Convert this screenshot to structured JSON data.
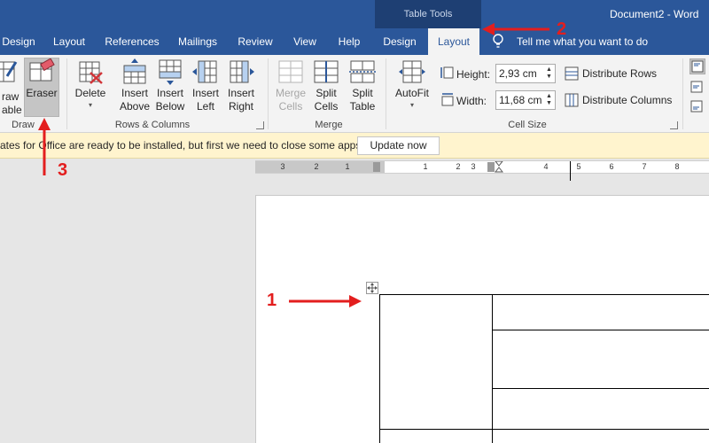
{
  "window": {
    "contextual_group": "Table Tools",
    "document_title": "Document2 - Word"
  },
  "tabs": [
    {
      "label": "Design"
    },
    {
      "label": "Layout"
    },
    {
      "label": "References"
    },
    {
      "label": "Mailings"
    },
    {
      "label": "Review"
    },
    {
      "label": "View"
    },
    {
      "label": "Help"
    },
    {
      "label": "Design"
    },
    {
      "label": "Layout",
      "active": true
    }
  ],
  "tell_me": "Tell me what you want to do",
  "ribbon": {
    "draw": {
      "draw_table": [
        "raw",
        "able"
      ],
      "eraser": "Eraser",
      "group_label": "Draw"
    },
    "rows_columns": {
      "delete": "Delete",
      "insert_above": [
        "Insert",
        "Above"
      ],
      "insert_below": [
        "Insert",
        "Below"
      ],
      "insert_left": [
        "Insert",
        "Left"
      ],
      "insert_right": [
        "Insert",
        "Right"
      ],
      "group_label": "Rows & Columns"
    },
    "merge": {
      "merge_cells": [
        "Merge",
        "Cells"
      ],
      "split_cells": [
        "Split",
        "Cells"
      ],
      "split_table": [
        "Split",
        "Table"
      ],
      "group_label": "Merge"
    },
    "cell_size": {
      "autofit": "AutoFit",
      "height_label": "Height:",
      "height_value": "2,93 cm",
      "width_label": "Width:",
      "width_value": "11,68 cm",
      "distribute_rows": "Distribute Rows",
      "distribute_columns": "Distribute Columns",
      "group_label": "Cell Size"
    }
  },
  "notification": {
    "message": "ates for Office are ready to be installed, but first we need to close some apps.",
    "button": "Update now"
  },
  "ruler": {
    "labels": [
      "3",
      "2",
      "1",
      "1",
      "2",
      "3",
      "4",
      "5",
      "6",
      "7",
      "8"
    ]
  },
  "annotations": {
    "one": "1",
    "two": "2",
    "three": "3"
  },
  "colors": {
    "title_bar": "#2b579a",
    "ribbon": "#f3f3f3",
    "notification": "#fff4ce",
    "annotation": "#e31e1e"
  }
}
